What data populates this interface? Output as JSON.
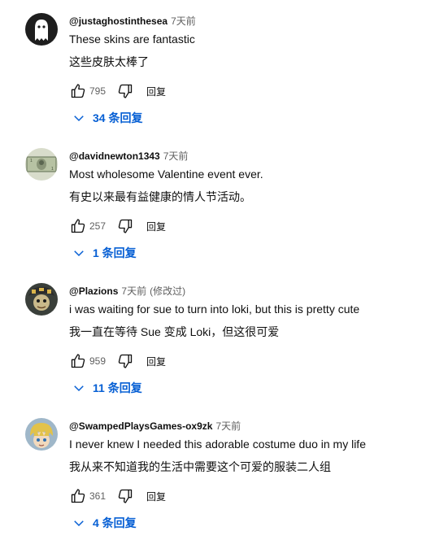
{
  "reply_label": "回复",
  "colors": {
    "link_blue": "#065fd4",
    "secondary_text": "#606060",
    "primary_text": "#0f0f0f"
  },
  "comments": [
    {
      "author": "@justaghostinthesea",
      "time": "7天前",
      "edited": "",
      "text_en": "These skins are fantastic",
      "text_zh": "这些皮肤太棒了",
      "likes": "795",
      "replies": "34 条回复",
      "avatar_icon": "ghost-avatar-icon"
    },
    {
      "author": "@davidnewton1343",
      "time": "7天前",
      "edited": "",
      "text_en": "Most wholesome Valentine event ever.",
      "text_zh": "有史以来最有益健康的情人节活动。",
      "likes": "257",
      "replies": "1 条回复",
      "avatar_icon": "dollar-bill-avatar-icon"
    },
    {
      "author": "@Plazions",
      "time": "7天前",
      "edited": "(修改过)",
      "text_en": "i was waiting for sue to turn into loki, but this is pretty cute",
      "text_zh": "我一直在等待 Sue 变成 Loki，但这很可爱",
      "likes": "959",
      "replies": "11 条回复",
      "avatar_icon": "character-avatar-icon"
    },
    {
      "author": "@SwampedPlaysGames-ox9zk",
      "time": "7天前",
      "edited": "",
      "text_en": "I never knew I needed this adorable costume duo in my life",
      "text_zh": "我从来不知道我的生活中需要这个可爱的服装二人组",
      "likes": "361",
      "replies": "4 条回复",
      "avatar_icon": "anime-avatar-icon"
    }
  ]
}
